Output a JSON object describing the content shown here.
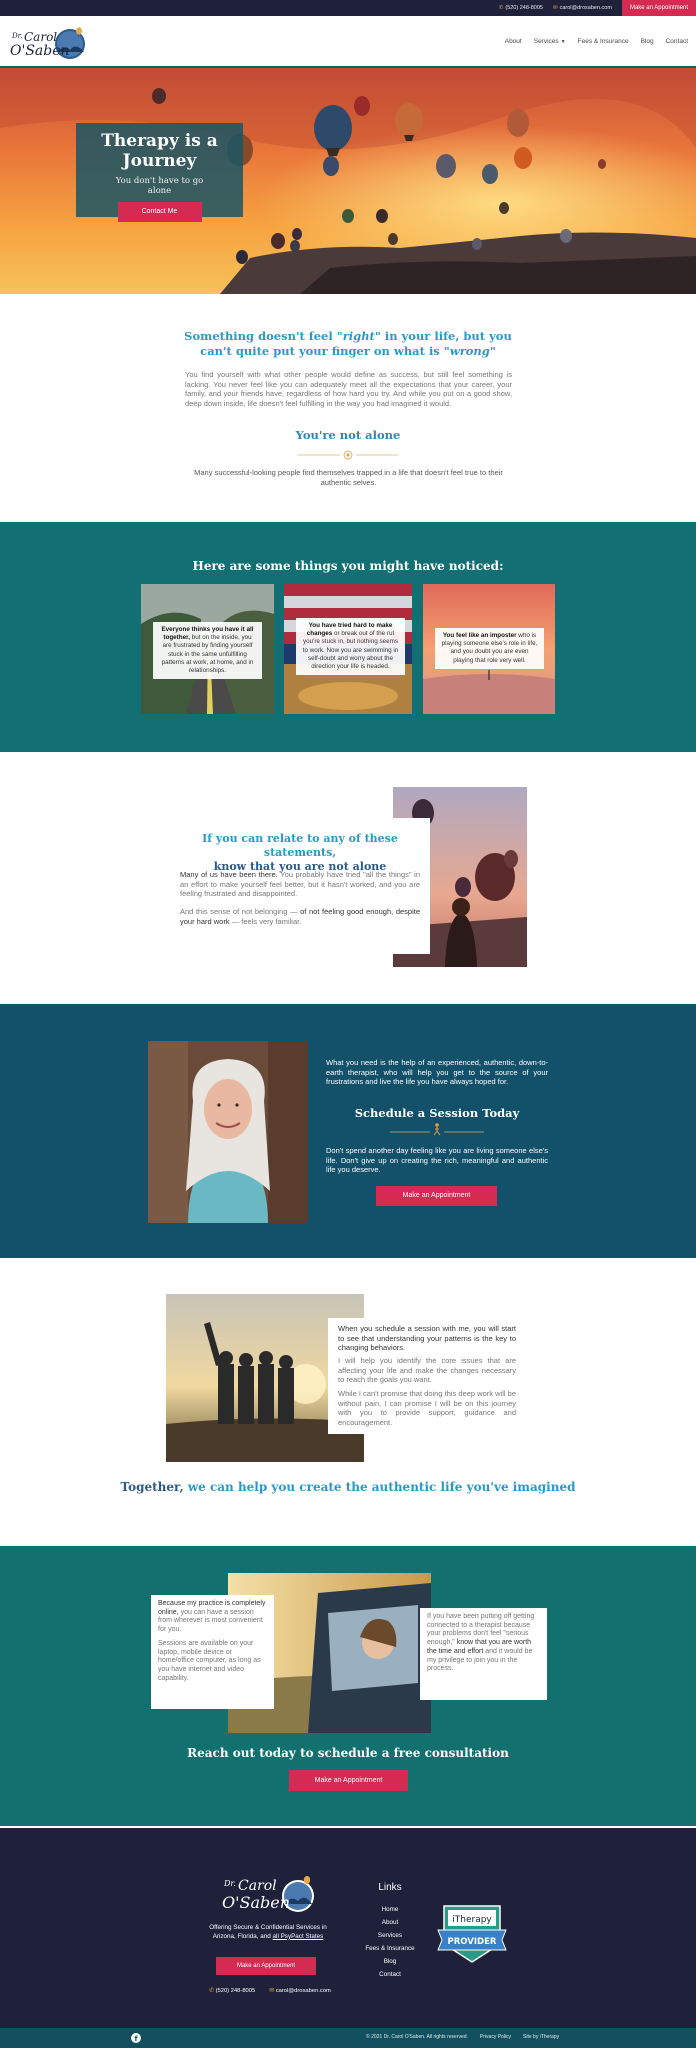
{
  "topbar": {
    "phone": "(520) 248-8005",
    "email": "carol@drosaben.com",
    "cta_label": "Make an Appointment"
  },
  "header": {
    "logo_title": "Dr. Carol O'Saben",
    "nav": [
      "About",
      "Services",
      "Fees & Insurance",
      "Blog",
      "Contact"
    ]
  },
  "hero": {
    "title_line1": "Therapy is a",
    "title_line2": "Journey",
    "subtitle_line1": "You don't have to go",
    "subtitle_line2": "alone",
    "button_label": "Contact Me"
  },
  "intro": {
    "heading_a": "Something doesn't feel ",
    "heading_em1": "\"right\"",
    "heading_b": " in your life, but you can't quite put your finger on what is ",
    "heading_em2": "\"wrong\"",
    "body": "You find yourself with what other people would define as success, but still feel something is lacking. You never feel like you can adequately meet all the expectations that your career, your family, and your friends have, regardless of how hard you try. And while you put on a good show, deep down inside, life doesn't feel fulfilling in the way you had imagined it would.",
    "subheading": "You're not alone",
    "sub_body": "Many successful-looking people find themselves trapped in a life that doesn't feel true to their authentic selves."
  },
  "noticed": {
    "heading": "Here are some things you might have noticed:",
    "cards": [
      {
        "bold": "Everyone thinks you have it all together,",
        "rest": " but on the inside, you are frustrated by finding yourself stuck in the same unfulfilling patterns at work, at home, and in relationships."
      },
      {
        "bold": "You have tried hard to make changes",
        "rest": " or break out of the rut you're stuck in, but nothing seems to work. Now you are swimming in self-doubt and worry about the direction your life is headed."
      },
      {
        "bold": "You feel like an imposter",
        "rest": " who is playing someone else's role in life, and you doubt you are even playing that role very well."
      }
    ]
  },
  "relate": {
    "heading_a": "If you can relate to any of these statements,",
    "heading_b": "know that you are not alone",
    "p1_bold": "Many of us have been there.",
    "p1_rest": " You probably have tried \"all the things\" in an effort to make yourself feel better, but it hasn't worked, and you are feeling frustrated and disappointed.",
    "p2_a": "And this sense of not belonging — ",
    "p2_bold": "of not feeling good enough, despite your hard work",
    "p2_b": " — feels very familiar."
  },
  "schedule": {
    "p1": "What you need is the help of an experienced, authentic, down-to-earth therapist, who will help you get to the source of your frustrations and live the life you have always hoped for.",
    "heading": "Schedule a Session Today",
    "p2": "Don't spend another day feeling like you are living someone else's life. Don't give up on creating the rich, meaningful and authentic life you deserve.",
    "button_label": "Make an Appointment"
  },
  "together": {
    "p1_bold": "When you schedule a session with me, you will start to see that understanding your patterns is the key to changing behaviors.",
    "p2": "I will help you identify the core issues that are affecting your life and make the changes necessary to reach the goals you want.",
    "p3": "While I can't promise that doing this deep work will be without pain, I can promise I will be on this journey with you to provide support, guidance and encouragement.",
    "heading_em": "Together,",
    "heading_rest": " we can help you create the authentic life you've imagined"
  },
  "online": {
    "left_bold": "Because my practice is completely online,",
    "left_rest": " you can have a session from wherever is most convenient for you.",
    "left_p2": "Sessions are available on your laptop, mobile device or home/office computer, as long as you have internet and video capability.",
    "right_a": "If you have been putting off getting connected to a therapist because your problems don't feel \"serious enough,\"",
    "right_bold": " know that you are worth the time and effort",
    "right_b": " and it would be my privilege to join you in the process.",
    "heading": "Reach out today to schedule a free consultation",
    "button_label": "Make an Appointment"
  },
  "footer": {
    "logo_title": "Dr. Carol O'Saben",
    "tagline": "Offering Secure & Confidential Services in Arizona, Florida, and ",
    "tagline_link": "all PsyPact States",
    "button_label": "Make an Appointment",
    "phone": "(520) 248-8005",
    "email": "carol@drosaben.com",
    "links_heading": "Links",
    "links": [
      "Home",
      "About",
      "Services",
      "Fees & Insurance",
      "Blog",
      "Contact"
    ],
    "badge_top": "iTherapy",
    "badge_bottom": "PROVIDER",
    "copyright": "© 2021 Dr. Carol O'Saben. All rights reserved.",
    "privacy": "Privacy Policy",
    "site_by": "Site by iTherapy"
  },
  "colors": {
    "navy": "#1e2139",
    "teal": "#126f73",
    "blue_teal": "#13506a",
    "accent_red": "#d52b52",
    "heading_blue": "#2a98c8"
  }
}
